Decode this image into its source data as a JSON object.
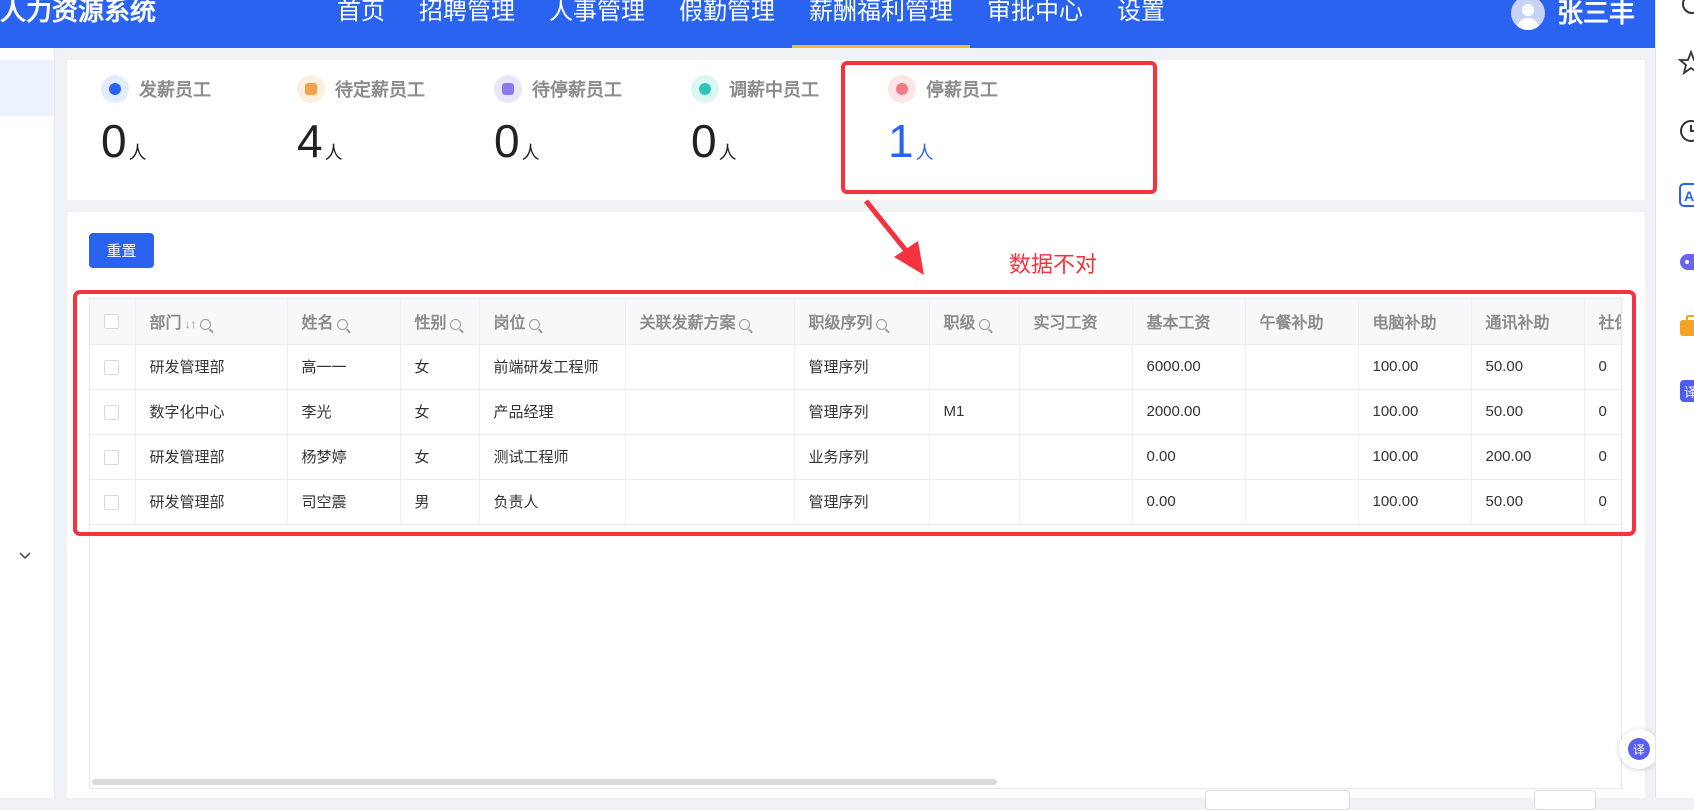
{
  "header": {
    "app_title": "人力资源系统",
    "nav": [
      "首页",
      "招聘管理",
      "人事管理",
      "假勤管理",
      "薪酬福利管理",
      "审批中心",
      "设置"
    ],
    "active_nav_index": 4,
    "user_name": "张三丰"
  },
  "stats": [
    {
      "label": "发薪员工",
      "value": "0",
      "unit": "人",
      "icon": "moneybag-icon",
      "icon_bg": "#e3ecff",
      "icon_color": "#2a63ef"
    },
    {
      "label": "待定薪员工",
      "value": "4",
      "unit": "人",
      "icon": "hourglass-icon",
      "icon_bg": "#fdeedd",
      "icon_color": "#f1a24a"
    },
    {
      "label": "待停薪员工",
      "value": "0",
      "unit": "人",
      "icon": "hourglass-icon",
      "icon_bg": "#e9e6fb",
      "icon_color": "#8a7cf0"
    },
    {
      "label": "调薪中员工",
      "value": "0",
      "unit": "人",
      "icon": "coins-icon",
      "icon_bg": "#dcf6f3",
      "icon_color": "#2fc4b2"
    },
    {
      "label": "停薪员工",
      "value": "1",
      "unit": "人",
      "icon": "moneybag-off-icon",
      "icon_bg": "#fde4e6",
      "icon_color": "#f07985",
      "active": true
    }
  ],
  "toolbar": {
    "reset_label": "重置"
  },
  "annotation": {
    "text": "数据不对",
    "color": "#f5333f"
  },
  "table": {
    "columns": [
      "部门",
      "姓名",
      "性别",
      "岗位",
      "关联发薪方案",
      "职级序列",
      "职级",
      "实习工资",
      "基本工资",
      "午餐补助",
      "电脑补助",
      "通讯补助",
      "社保"
    ],
    "rows": [
      [
        "研发管理部",
        "高一一",
        "女",
        "前端研发工程师",
        "",
        "管理序列",
        "",
        "",
        "6000.00",
        "",
        "100.00",
        "50.00",
        "0"
      ],
      [
        "数字化中心",
        "李光",
        "女",
        "产品经理",
        "",
        "管理序列",
        "M1",
        "",
        "2000.00",
        "",
        "100.00",
        "50.00",
        "0"
      ],
      [
        "研发管理部",
        "杨梦婷",
        "女",
        "测试工程师",
        "",
        "业务序列",
        "",
        "",
        "0.00",
        "",
        "100.00",
        "200.00",
        "0"
      ],
      [
        "研发管理部",
        "司空震",
        "男",
        "负责人",
        "",
        "管理序列",
        "",
        "",
        "0.00",
        "",
        "100.00",
        "50.00",
        "0"
      ]
    ]
  },
  "colors": {
    "primary": "#2a63ef",
    "nav_active_underline": "#f5b83d",
    "annotation_red": "#f5333f"
  }
}
